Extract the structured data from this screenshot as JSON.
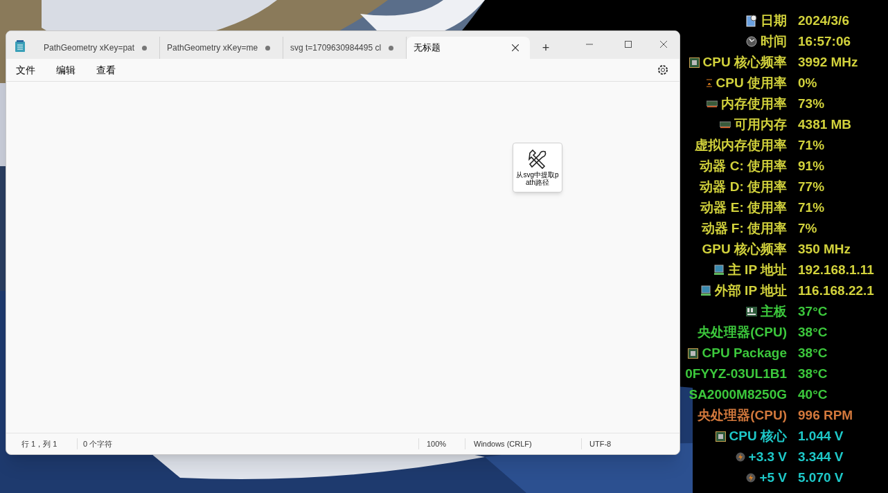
{
  "notepad": {
    "tabs": [
      {
        "label": "PathGeometry xKey=pat",
        "selected": false,
        "modified": true
      },
      {
        "label": "PathGeometry xKey=me",
        "selected": false,
        "modified": true
      },
      {
        "label": "svg t=1709630984495 cl",
        "selected": false,
        "modified": true
      },
      {
        "label": "无标题",
        "selected": true,
        "modified": false
      }
    ],
    "new_tab": "+",
    "menu": [
      "文件",
      "编辑",
      "查看"
    ],
    "floating_tool": {
      "label": "从svg中提取path路径"
    },
    "status_bar": {
      "position": "行 1，列 1",
      "characters": "0 个字符",
      "zoom": "100%",
      "line_ending": "Windows (CRLF)",
      "encoding": "UTF-8"
    }
  },
  "monitor": [
    {
      "kind": "date",
      "label": "日期",
      "value": "2024/3/6",
      "color": "#d2d23c"
    },
    {
      "kind": "time",
      "label": "时间",
      "value": "16:57:06",
      "color": "#d2d23c"
    },
    {
      "kind": "chip",
      "label": "CPU 核心频率",
      "value": "3992 MHz",
      "color": "#d2d23c"
    },
    {
      "kind": "load",
      "label": "CPU 使用率",
      "value": "0%",
      "color": "#d2d23c"
    },
    {
      "kind": "memory",
      "label": "内存使用率",
      "value": "73%",
      "color": "#d2d23c"
    },
    {
      "kind": "memory",
      "label": "可用内存",
      "value": "4381 MB",
      "color": "#d2d23c"
    },
    {
      "kind": "plain",
      "label": "虚拟内存使用率",
      "value": "71%",
      "color": "#d2d23c"
    },
    {
      "kind": "plain",
      "label": "动器 C: 使用率",
      "value": "91%",
      "color": "#d2d23c"
    },
    {
      "kind": "plain",
      "label": "动器 D: 使用率",
      "value": "77%",
      "color": "#d2d23c"
    },
    {
      "kind": "plain",
      "label": "动器 E: 使用率",
      "value": "71%",
      "color": "#d2d23c"
    },
    {
      "kind": "plain",
      "label": "动器 F: 使用率",
      "value": "7%",
      "color": "#d2d23c"
    },
    {
      "kind": "plain",
      "label": "GPU 核心频率",
      "value": "350 MHz",
      "color": "#d2d23c"
    },
    {
      "kind": "network",
      "label": "主 IP 地址",
      "value": "192.168.1.11",
      "color": "#d2d23c"
    },
    {
      "kind": "network",
      "label": "外部 IP 地址",
      "value": "116.168.22.1",
      "color": "#d2d23c"
    },
    {
      "kind": "board",
      "label": "主板",
      "value": "37°C",
      "color": "#3cc83c"
    },
    {
      "kind": "plain",
      "label": "央处理器(CPU)",
      "value": "38°C",
      "color": "#3cc83c"
    },
    {
      "kind": "chip",
      "label": "CPU Package",
      "value": "38°C",
      "color": "#3cc83c"
    },
    {
      "kind": "plain",
      "label": "0FYYZ-03UL1B1",
      "value": "38°C",
      "color": "#3cc83c"
    },
    {
      "kind": "plain",
      "label": "SA2000M8250G",
      "value": "40°C",
      "color": "#3cc83c"
    },
    {
      "kind": "plain",
      "label": "央处理器(CPU)",
      "value": "996 RPM",
      "color": "#d2783c"
    },
    {
      "kind": "chip",
      "label": "CPU 核心",
      "value": "1.044 V",
      "color": "#1ec8c8"
    },
    {
      "kind": "voltage",
      "label": "+3.3 V",
      "value": "3.344 V",
      "color": "#1ec8c8"
    },
    {
      "kind": "voltage",
      "label": "+5 V",
      "value": "5.070 V",
      "color": "#1ec8c8"
    }
  ]
}
